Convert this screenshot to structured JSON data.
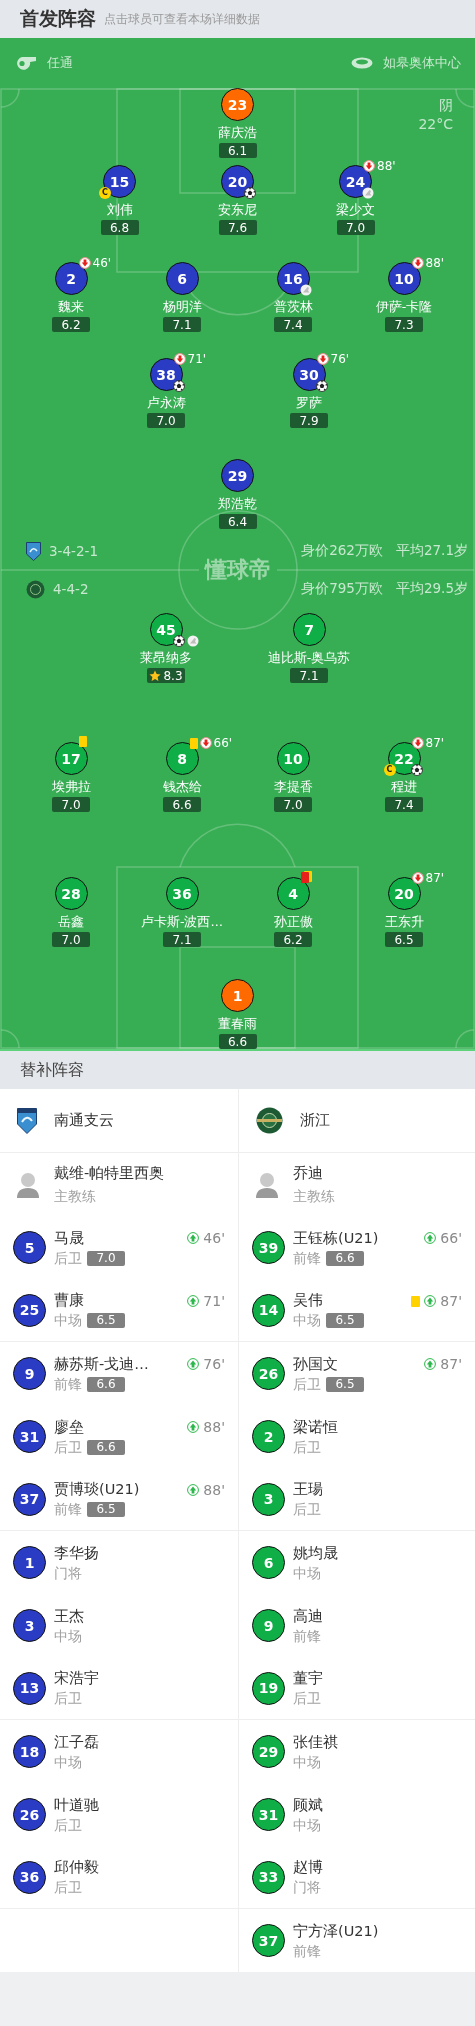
{
  "header": {
    "title": "首发阵容",
    "hint": "点击球员可查看本场详细数据"
  },
  "pitch": {
    "referee": "任通",
    "venue": "如皋奥体中心",
    "weather": "阴",
    "temperature": "22°C",
    "logo_text": "懂球帝",
    "teams": [
      {
        "color": "#2b3cc4",
        "formation": "3-4-2-1",
        "value": "身价262万欧",
        "average_age": "平均27.1岁",
        "goalkeeper": {
          "number": "23",
          "name": "薛庆浩",
          "rating": "6.1"
        },
        "formation_lines": [
          [
            {
              "number": "15",
              "name": "刘伟",
              "rating": "6.8",
              "badges": [
                {
                  "kind": "captain",
                  "label": "C"
                }
              ]
            },
            {
              "number": "20",
              "name": "安东尼",
              "rating": "7.6",
              "badges": [
                {
                  "kind": "goal"
                }
              ]
            },
            {
              "number": "24",
              "name": "梁少文",
              "rating": "7.0",
              "sub_off": "88'",
              "badges": [
                {
                  "kind": "assist"
                }
              ]
            }
          ],
          [
            {
              "number": "2",
              "name": "魏来",
              "rating": "6.2",
              "sub_off": "46'"
            },
            {
              "number": "6",
              "name": "杨明洋",
              "rating": "7.1"
            },
            {
              "number": "16",
              "name": "普茨林",
              "rating": "7.4",
              "badges": [
                {
                  "kind": "assist"
                }
              ]
            },
            {
              "number": "10",
              "name": "伊萨-卡隆",
              "rating": "7.3",
              "sub_off": "88'"
            }
          ],
          [
            {
              "number": "38",
              "name": "卢永涛",
              "rating": "7.0",
              "sub_off": "71'",
              "badges": [
                {
                  "kind": "goal"
                }
              ]
            },
            {
              "number": "30",
              "name": "罗萨",
              "rating": "7.9",
              "sub_off": "76'",
              "badges": [
                {
                  "kind": "goal"
                }
              ]
            }
          ],
          [
            {
              "number": "29",
              "name": "郑浩乾",
              "rating": "6.4"
            }
          ]
        ]
      },
      {
        "color": "#0fae47",
        "formation": "4-4-2",
        "value": "身价795万欧",
        "average_age": "平均29.5岁",
        "goalkeeper": {
          "number": "1",
          "name": "董春雨",
          "rating": "6.6"
        },
        "formation_lines": [
          [
            {
              "number": "45",
              "name": "莱昂纳多",
              "rating": "8.3",
              "badges": [
                {
                  "kind": "goal"
                },
                {
                  "kind": "assist"
                },
                {
                  "kind": "best"
                }
              ]
            },
            {
              "number": "7",
              "name": "迪比斯-奥乌苏",
              "rating": "7.1"
            }
          ],
          [
            {
              "number": "17",
              "name": "埃弗拉",
              "rating": "7.0",
              "badges": [
                {
                  "kind": "yellow_card"
                }
              ]
            },
            {
              "number": "8",
              "name": "钱杰给",
              "rating": "6.6",
              "sub_off": "66'",
              "badges": [
                {
                  "kind": "yellow_card"
                }
              ]
            },
            {
              "number": "10",
              "name": "李提香",
              "rating": "7.0"
            },
            {
              "number": "22",
              "name": "程进",
              "rating": "7.4",
              "sub_off": "87'",
              "badges": [
                {
                  "kind": "captain",
                  "label": "C"
                },
                {
                  "kind": "goal"
                }
              ]
            }
          ],
          [
            {
              "number": "28",
              "name": "岳鑫",
              "rating": "7.0"
            },
            {
              "number": "36",
              "name": "卢卡斯-波西…",
              "rating": "7.1"
            },
            {
              "number": "4",
              "name": "孙正傲",
              "rating": "6.2",
              "badges": [
                {
                  "kind": "red_card"
                }
              ]
            },
            {
              "number": "20",
              "name": "王东升",
              "rating": "6.5",
              "sub_off": "87'"
            }
          ]
        ]
      }
    ]
  },
  "substitutes": {
    "title": "替补阵容",
    "teams": [
      {
        "name": "南通支云",
        "color": "#2b3cc4",
        "coach": {
          "name": "戴维-帕特里西奥",
          "role": "主教练"
        },
        "players": [
          {
            "number": "5",
            "name": "马晟",
            "position": "后卫",
            "rating": "7.0",
            "sub_on": "46'"
          },
          {
            "number": "25",
            "name": "曹康",
            "position": "中场",
            "rating": "6.5",
            "sub_on": "71'"
          },
          {
            "number": "9",
            "name": "赫苏斯-戈迪…",
            "position": "前锋",
            "rating": "6.6",
            "sub_on": "76'"
          },
          {
            "number": "31",
            "name": "廖垒",
            "position": "后卫",
            "rating": "6.6",
            "sub_on": "88'"
          },
          {
            "number": "37",
            "name": "贾博琰(U21)",
            "position": "前锋",
            "rating": "6.5",
            "sub_on": "88'"
          },
          {
            "number": "1",
            "name": "李华扬",
            "position": "门将"
          },
          {
            "number": "3",
            "name": "王杰",
            "position": "中场"
          },
          {
            "number": "13",
            "name": "宋浩宇",
            "position": "后卫"
          },
          {
            "number": "18",
            "name": "江子磊",
            "position": "中场"
          },
          {
            "number": "26",
            "name": "叶道驰",
            "position": "后卫"
          },
          {
            "number": "36",
            "name": "邱仲毅",
            "position": "后卫"
          }
        ]
      },
      {
        "name": "浙江",
        "color": "#0fae47",
        "coach": {
          "name": "乔迪",
          "role": "主教练"
        },
        "players": [
          {
            "number": "39",
            "name": "王钰栋(U21)",
            "position": "前锋",
            "rating": "6.6",
            "sub_on": "66'"
          },
          {
            "number": "14",
            "name": "吴伟",
            "position": "中场",
            "rating": "6.5",
            "sub_on": "87'",
            "badges": [
              {
                "kind": "yellow_card"
              }
            ]
          },
          {
            "number": "26",
            "name": "孙国文",
            "position": "后卫",
            "rating": "6.5",
            "sub_on": "87'"
          },
          {
            "number": "2",
            "name": "梁诺恒",
            "position": "后卫"
          },
          {
            "number": "3",
            "name": "王瑒",
            "position": "后卫"
          },
          {
            "number": "6",
            "name": "姚均晟",
            "position": "中场"
          },
          {
            "number": "9",
            "name": "高迪",
            "position": "前锋"
          },
          {
            "number": "19",
            "name": "董宇",
            "position": "后卫"
          },
          {
            "number": "29",
            "name": "张佳祺",
            "position": "中场"
          },
          {
            "number": "31",
            "name": "顾斌",
            "position": "中场"
          },
          {
            "number": "33",
            "name": "赵博",
            "position": "门将"
          },
          {
            "number": "37",
            "name": "宁方泽(U21)",
            "position": "前锋"
          }
        ]
      }
    ]
  }
}
